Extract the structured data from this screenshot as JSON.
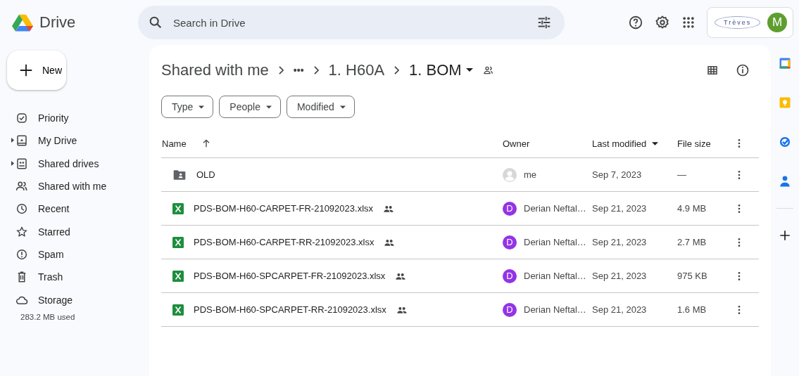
{
  "app": {
    "name": "Drive"
  },
  "search": {
    "placeholder": "Search in Drive"
  },
  "account": {
    "org_name": "Trèves",
    "avatar_initial": "M"
  },
  "new_button": {
    "label": "New"
  },
  "sidebar": {
    "items": [
      {
        "label": "Priority",
        "kind": "priority",
        "expandable": false,
        "selected": false
      },
      {
        "label": "My Drive",
        "kind": "mydrive",
        "expandable": true,
        "selected": false
      },
      {
        "label": "Shared drives",
        "kind": "shareddrives",
        "expandable": true,
        "selected": false
      },
      {
        "label": "Shared with me",
        "kind": "shared",
        "expandable": false,
        "selected": false
      },
      {
        "label": "Recent",
        "kind": "recent",
        "expandable": false,
        "selected": false
      },
      {
        "label": "Starred",
        "kind": "starred",
        "expandable": false,
        "selected": false
      },
      {
        "label": "Spam",
        "kind": "spam",
        "expandable": false,
        "selected": false
      },
      {
        "label": "Trash",
        "kind": "trash",
        "expandable": false,
        "selected": false
      },
      {
        "label": "Storage",
        "kind": "storage",
        "expandable": false,
        "selected": false
      }
    ],
    "storage_used": "283.2 MB used"
  },
  "breadcrumb": [
    "Shared with me",
    "•••",
    "1. H60A",
    "1. BOM"
  ],
  "filters": [
    "Type",
    "People",
    "Modified"
  ],
  "table": {
    "columns": [
      {
        "label": "Name",
        "sorted": true,
        "has_menu": false
      },
      {
        "label": "Owner",
        "sorted": false,
        "has_menu": false
      },
      {
        "label": "Last modified",
        "sorted": false,
        "has_menu": true
      },
      {
        "label": "File size",
        "sorted": false,
        "has_menu": false
      }
    ],
    "rows": [
      {
        "kind": "folder",
        "name": "OLD",
        "shared": false,
        "owner": {
          "kind": "me",
          "name": "me"
        },
        "modified": "Sep 7, 2023",
        "size": "—"
      },
      {
        "kind": "xlsx",
        "name": "PDS-BOM-H60-CARPET-FR-21092023.xlsx",
        "shared": true,
        "owner": {
          "kind": "user",
          "name": "Derian Neftal…",
          "initial": "D",
          "color": "#9334e6"
        },
        "modified": "Sep 21, 2023",
        "size": "4.9 MB"
      },
      {
        "kind": "xlsx",
        "name": "PDS-BOM-H60-CARPET-RR-21092023.xlsx",
        "shared": true,
        "owner": {
          "kind": "user",
          "name": "Derian Neftal…",
          "initial": "D",
          "color": "#9334e6"
        },
        "modified": "Sep 21, 2023",
        "size": "2.7 MB"
      },
      {
        "kind": "xlsx",
        "name": "PDS-BOM-H60-SPCARPET-FR-21092023.xlsx",
        "shared": true,
        "owner": {
          "kind": "user",
          "name": "Derian Neftal…",
          "initial": "D",
          "color": "#9334e6"
        },
        "modified": "Sep 21, 2023",
        "size": "975 KB"
      },
      {
        "kind": "xlsx",
        "name": "PDS-BOM-H60-SPCARPET-RR-21092023.xlsx",
        "shared": true,
        "owner": {
          "kind": "user",
          "name": "Derian Neftal…",
          "initial": "D",
          "color": "#9334e6"
        },
        "modified": "Sep 21, 2023",
        "size": "1.6 MB"
      }
    ]
  }
}
